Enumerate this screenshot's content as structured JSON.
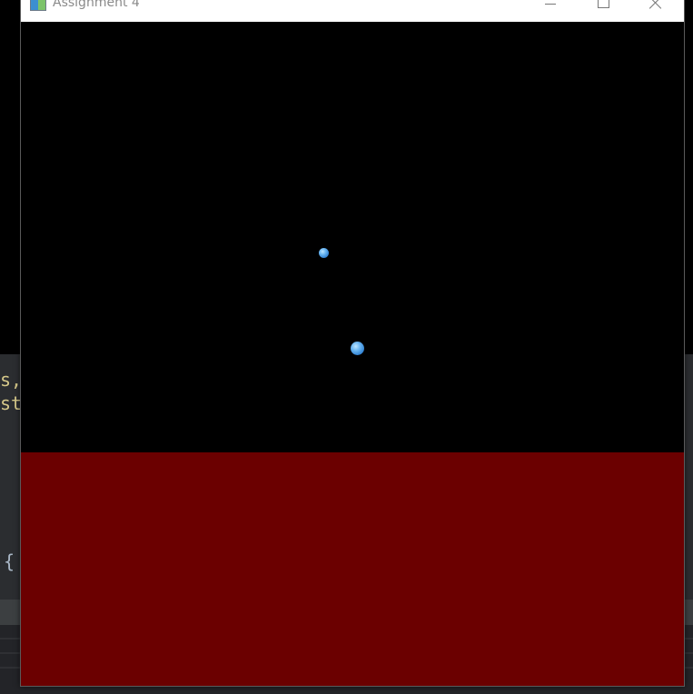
{
  "window": {
    "title": "Assignment 4"
  },
  "scene": {
    "background_color": "#000000",
    "floor_color": "#6b0000",
    "spheres": [
      {
        "name": "sphere-small",
        "color": "#5aa8ee"
      },
      {
        "name": "sphere-large",
        "color": "#5aa8ee"
      }
    ]
  },
  "editor_background": {
    "line1": "s,",
    "line2": "sti",
    "brace": "{"
  }
}
